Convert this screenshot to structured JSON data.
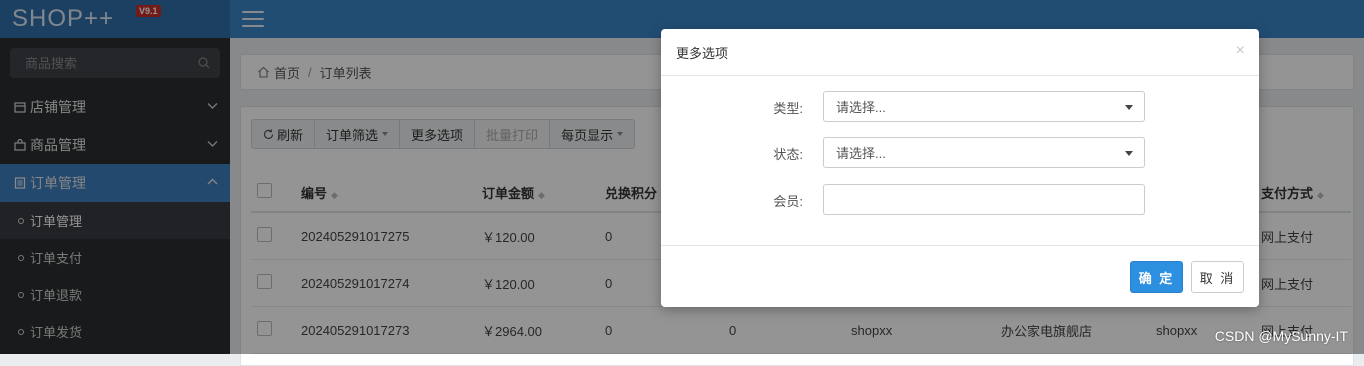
{
  "app": {
    "logo": "SHOP++",
    "version": "V9.1"
  },
  "sidebar": {
    "search_placeholder": "商品搜索",
    "menus": [
      {
        "label": "店铺管理",
        "icon": "store-icon",
        "expanded": false
      },
      {
        "label": "商品管理",
        "icon": "bag-icon",
        "expanded": false
      },
      {
        "label": "订单管理",
        "icon": "list-icon",
        "expanded": true
      }
    ],
    "sub_items": [
      {
        "label": "订单管理",
        "active": true
      },
      {
        "label": "订单支付",
        "active": false
      },
      {
        "label": "订单退款",
        "active": false
      },
      {
        "label": "订单发货",
        "active": false
      }
    ]
  },
  "breadcrumb": {
    "home": "首页",
    "separator": "/",
    "current": "订单列表"
  },
  "toolbar": {
    "refresh": "刷新",
    "filter": "订单筛选",
    "more": "更多选项",
    "batch_print": "批量打印",
    "page_size": "每页显示"
  },
  "table": {
    "headers": {
      "sn": "编号",
      "amount": "订单金额",
      "points": "兑换积分",
      "payment": "支付方式"
    },
    "rows": [
      {
        "sn": "202405291017275",
        "amount": "￥120.00",
        "points": "0",
        "col4": "",
        "member": "",
        "store": "",
        "member2": "",
        "payment": "网上支付"
      },
      {
        "sn": "202405291017274",
        "amount": "￥120.00",
        "points": "0",
        "col4": "",
        "member": "",
        "store": "",
        "member2": "",
        "payment": "网上支付"
      },
      {
        "sn": "202405291017273",
        "amount": "￥2964.00",
        "points": "0",
        "col4": "0",
        "member": "shopxx",
        "store": "办公家电旗舰店",
        "member2": "shopxx",
        "payment": "网上支付"
      }
    ]
  },
  "modal": {
    "title": "更多选项",
    "close": "×",
    "type_label": "类型:",
    "type_value": "请选择...",
    "status_label": "状态:",
    "status_value": "请选择...",
    "member_label": "会员:",
    "member_value": "",
    "ok": "确 定",
    "cancel": "取 消"
  },
  "watermark": "CSDN @MySunny-IT",
  "colors": {
    "topbar": "#3a85c6",
    "sidebar": "#2b2d30",
    "active_menu": "#3f7fbf",
    "primary_button": "#2d8fe0"
  }
}
